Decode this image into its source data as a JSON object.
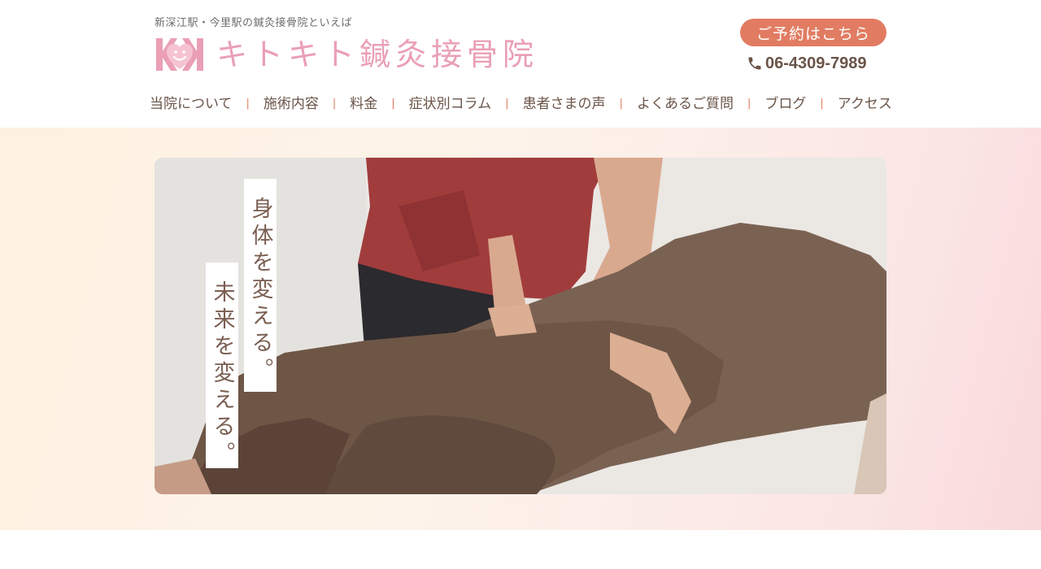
{
  "header": {
    "tagline": "新深江駅・今里駅の鍼灸接骨院といえば",
    "logo_text": "キトキト鍼灸接骨院",
    "reserve_label": "ご予約はこちら",
    "phone_number": "06-4309-7989"
  },
  "nav": {
    "items": [
      {
        "label": "当院について"
      },
      {
        "label": "施術内容"
      },
      {
        "label": "料金"
      },
      {
        "label": "症状別コラム"
      },
      {
        "label": "患者さまの声"
      },
      {
        "label": "よくあるご質問"
      },
      {
        "label": "ブログ"
      },
      {
        "label": "アクセス"
      }
    ],
    "separator": "|"
  },
  "hero": {
    "catch_line1": "身体を変える。",
    "catch_line2": "未来を変える。"
  },
  "colors": {
    "brand_pink": "#ea9fb5",
    "accent_orange": "#e17c62",
    "text_brown": "#6a5448"
  },
  "icons": {
    "logo": "heart-face-logo-icon",
    "phone": "phone-icon"
  }
}
